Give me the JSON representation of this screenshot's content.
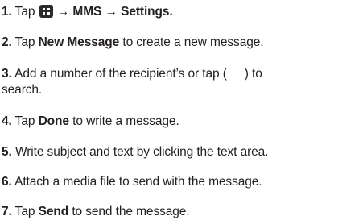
{
  "steps": [
    {
      "num": "1.",
      "pre": "Tap",
      "icon": "menu-grid-icon",
      "after_icon": "→ MMS → Settings."
    },
    {
      "num": "2.",
      "pre": "Tap",
      "bold": "New Message",
      "post": "to create a new message."
    },
    {
      "num": "3.",
      "pre": "Add a number of the recipient’s or tap (",
      "icon": "contacts-icon",
      "post": ") to",
      "cont": "search."
    },
    {
      "num": "4.",
      "pre": "Tap",
      "bold": "Done",
      "post": "to write a message."
    },
    {
      "num": "5.",
      "pre": "Write subject and text by clicking the text area."
    },
    {
      "num": "6.",
      "pre": "Attach a media file to send with the message."
    },
    {
      "num": "7.",
      "pre": "Tap",
      "bold": "Send",
      "post": "to send the message."
    }
  ]
}
